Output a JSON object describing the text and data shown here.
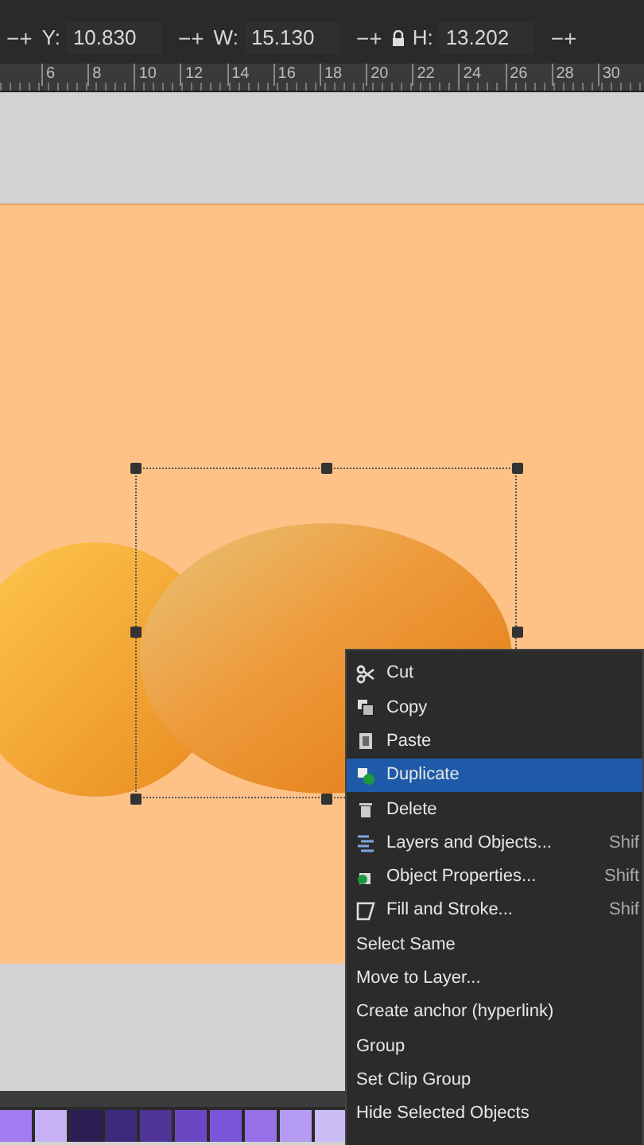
{
  "toolbar": {
    "fields": [
      {
        "stepper": "−+",
        "label": "Y:",
        "value": "10.830"
      },
      {
        "stepper": "−+",
        "label": "W:",
        "value": "15.130"
      },
      {
        "stepper": "−+",
        "label": "H:",
        "value": "13.202"
      }
    ],
    "end_stepper": "−+"
  },
  "ruler": {
    "labels": [
      "6",
      "8",
      "10",
      "12",
      "14",
      "16",
      "18",
      "20",
      "22",
      "24",
      "26",
      "28",
      "30"
    ]
  },
  "context_menu": {
    "items": [
      {
        "label": "Cut",
        "kind": "cut",
        "selected": false
      },
      {
        "label": "Copy",
        "kind": "copy",
        "selected": false
      },
      {
        "label": "Paste",
        "kind": "paste",
        "selected": false
      },
      {
        "label": "Duplicate",
        "kind": "duplicate",
        "selected": true
      },
      {
        "label": "Delete",
        "kind": "delete",
        "selected": false
      },
      {
        "label": "Layers and Objects...",
        "kind": "layers",
        "shortcut": "Shif",
        "selected": false
      },
      {
        "label": "Object Properties...",
        "kind": "properties",
        "shortcut": "Shift",
        "selected": false
      },
      {
        "label": "Fill and Stroke...",
        "kind": "fill",
        "shortcut": "Shif",
        "selected": false
      },
      {
        "label": "Select Same",
        "kind": "plain",
        "selected": false
      },
      {
        "label": "Move to Layer...",
        "kind": "plain",
        "selected": false
      },
      {
        "label": "Create anchor (hyperlink)",
        "kind": "plain",
        "selected": false
      },
      {
        "label": "Group",
        "kind": "plain",
        "selected": false
      },
      {
        "label": "Set Clip Group",
        "kind": "plain",
        "selected": false
      },
      {
        "label": "Hide Selected Objects",
        "kind": "plain",
        "selected": false
      }
    ]
  },
  "palette": {
    "swatches": [
      {
        "color": "#a27cf0"
      },
      {
        "color": "#c7b0f5"
      },
      {
        "color": "#2d1f55"
      },
      {
        "color": "#3d2a7a"
      },
      {
        "color": "#4f3496"
      },
      {
        "color": "#6a48c4"
      },
      {
        "color": "#7a55d8"
      },
      {
        "color": "#9570e6"
      },
      {
        "color": "#b49af0"
      },
      {
        "color": "#ccbcf6"
      }
    ]
  }
}
